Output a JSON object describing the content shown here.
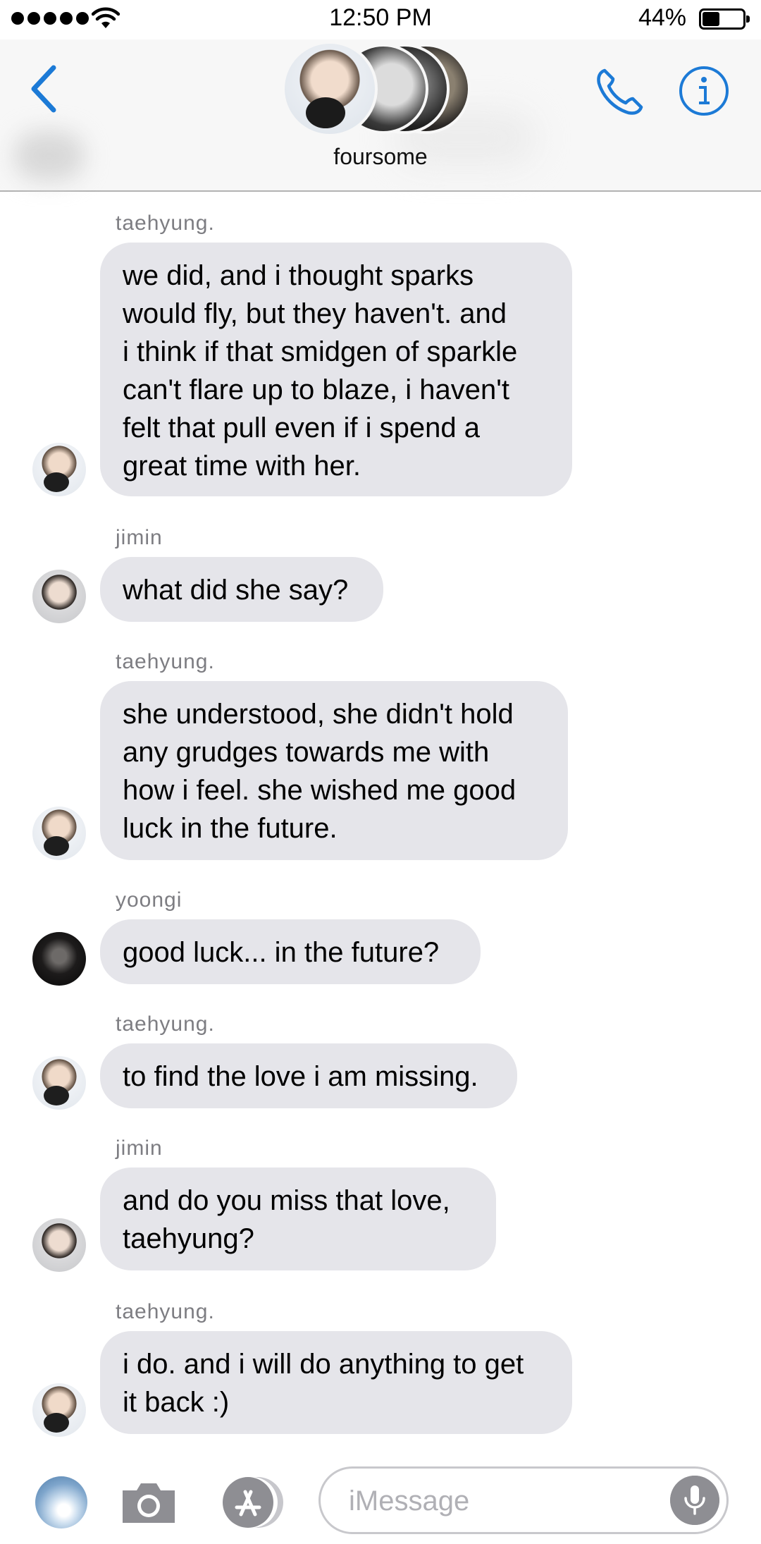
{
  "status_bar": {
    "time": "12:50 PM",
    "battery_percent": "44%",
    "battery_level": 0.44,
    "signal_bars": 5
  },
  "header": {
    "group_name": "foursome",
    "back_icon": "chevron-left-icon",
    "call_icon": "phone-icon",
    "info_icon": "info-icon",
    "accent_color": "#1c7ad6"
  },
  "messages": [
    {
      "sender": "taehyung.",
      "text": "we did, and i thought sparks\nwould fly, but they haven't. and\ni think if that smidgen of sparkle\ncan't flare up to blaze, i haven't\nfelt that pull even if i spend a\ngreat time with her."
    },
    {
      "sender": "jimin",
      "text": "what did she say?"
    },
    {
      "sender": "taehyung.",
      "text": "she understood, she didn't hold\nany grudges towards me with\nhow i feel. she wished me good\nluck in the future."
    },
    {
      "sender": "yoongi",
      "text": "good luck... in the future?"
    },
    {
      "sender": "taehyung.",
      "text": "to find the love i am missing."
    },
    {
      "sender": "jimin",
      "text": "and do you miss that love,\ntaehyung?"
    },
    {
      "sender": "taehyung.",
      "text": "i do. and i will do anything to get\nit back :)"
    }
  ],
  "input_bar": {
    "placeholder": "iMessage",
    "photos_icon": "photos-app-icon",
    "camera_icon": "camera-icon",
    "apps_icon": "app-store-icon",
    "mic_icon": "microphone-icon"
  },
  "colors": {
    "bubble_gray": "#e5e5ea",
    "sender_gray": "#7d7d82"
  }
}
